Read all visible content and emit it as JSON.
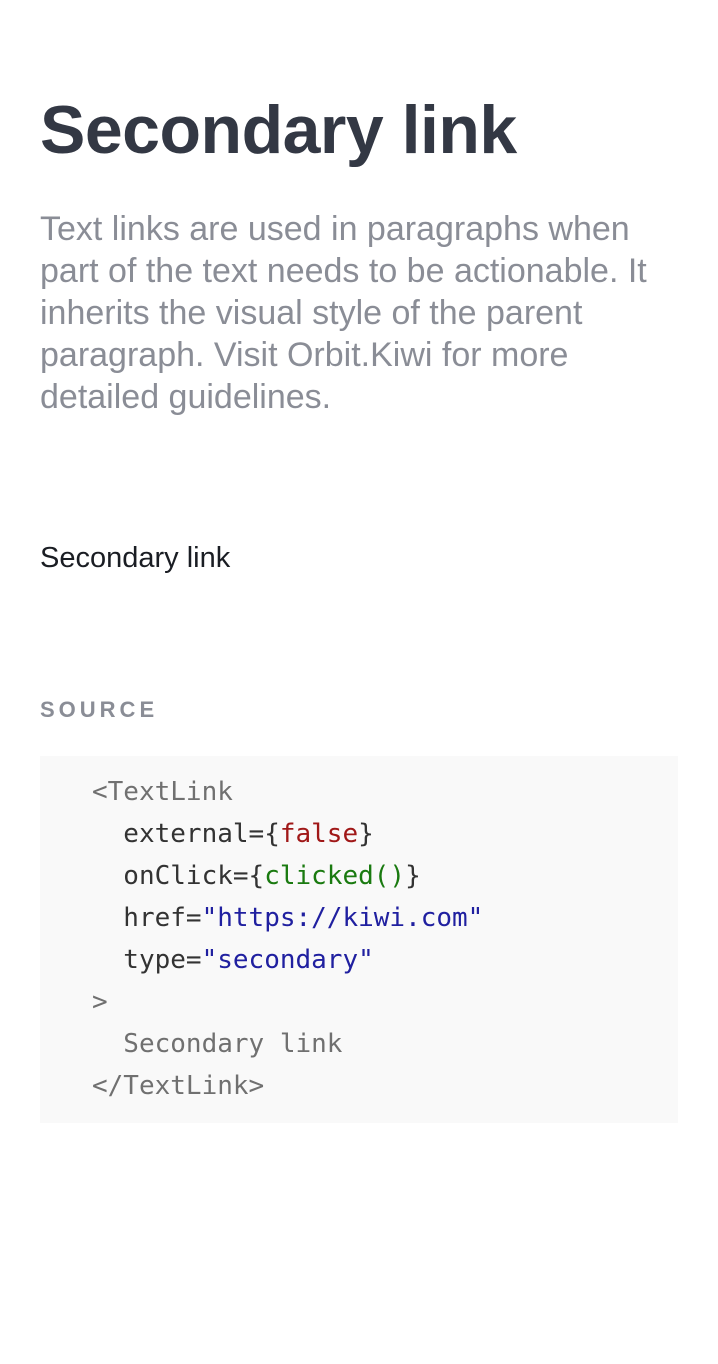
{
  "page": {
    "title": "Secondary link",
    "description": "Text links are used in paragraphs when part of the text needs to be actionable. It inherits the visual style of the parent paragraph. Visit Orbit.Kiwi for more detailed guidelines."
  },
  "example": {
    "link_label": "Secondary link"
  },
  "source": {
    "label": "SOURCE",
    "code": {
      "open_tag": "<TextLink",
      "attr_external": "  external=",
      "brace_open": "{",
      "brace_close": "}",
      "val_external": "false",
      "attr_onclick": "  onClick=",
      "val_onclick": "clicked()",
      "attr_href": "  href=",
      "val_href": "\"https://kiwi.com\"",
      "attr_type": "  type=",
      "val_type": "\"secondary\"",
      "tag_close": ">",
      "child_text": "  Secondary link",
      "close_tag": "</TextLink>"
    }
  },
  "colors": {
    "title": "#333844",
    "muted": "#8a8d96",
    "link": "#1a1d23",
    "code_background": "#f9f9f9",
    "code_boolean": "#a01818",
    "code_function": "#1a7a10",
    "code_string": "#2020a0"
  }
}
